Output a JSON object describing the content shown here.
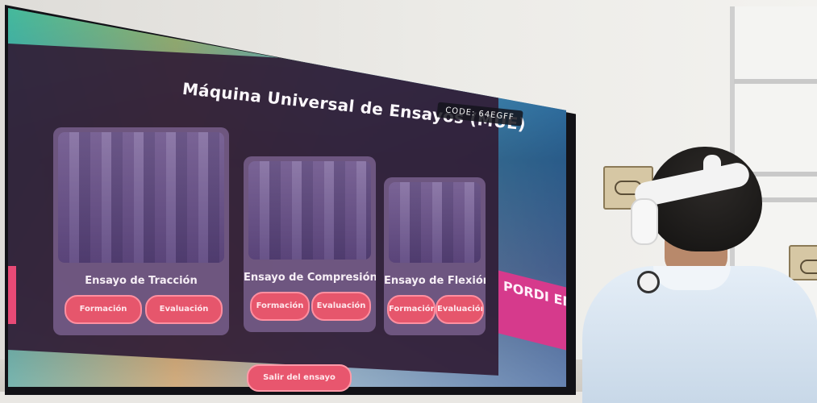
{
  "vr_app": {
    "title": "Máquina Universal de Ensayos (MUE)",
    "code": "CODE: 64EGFF",
    "cards": [
      {
        "label": "Ensayo de Tracción",
        "buttons": [
          "Formación",
          "Evaluación"
        ]
      },
      {
        "label": "Ensayo de Compresión",
        "buttons": [
          "Formación",
          "Evaluación"
        ]
      },
      {
        "label": "Ensayo de Flexión",
        "buttons": [
          "Formación",
          "Evaluación"
        ]
      }
    ],
    "exit_button": "Salir del ensayo",
    "sign_text": "PORDI EN"
  },
  "colors": {
    "panel": "#32203a",
    "button": "#e6566c",
    "sign": "#d63a8c",
    "shirt": "#dce8f3"
  }
}
